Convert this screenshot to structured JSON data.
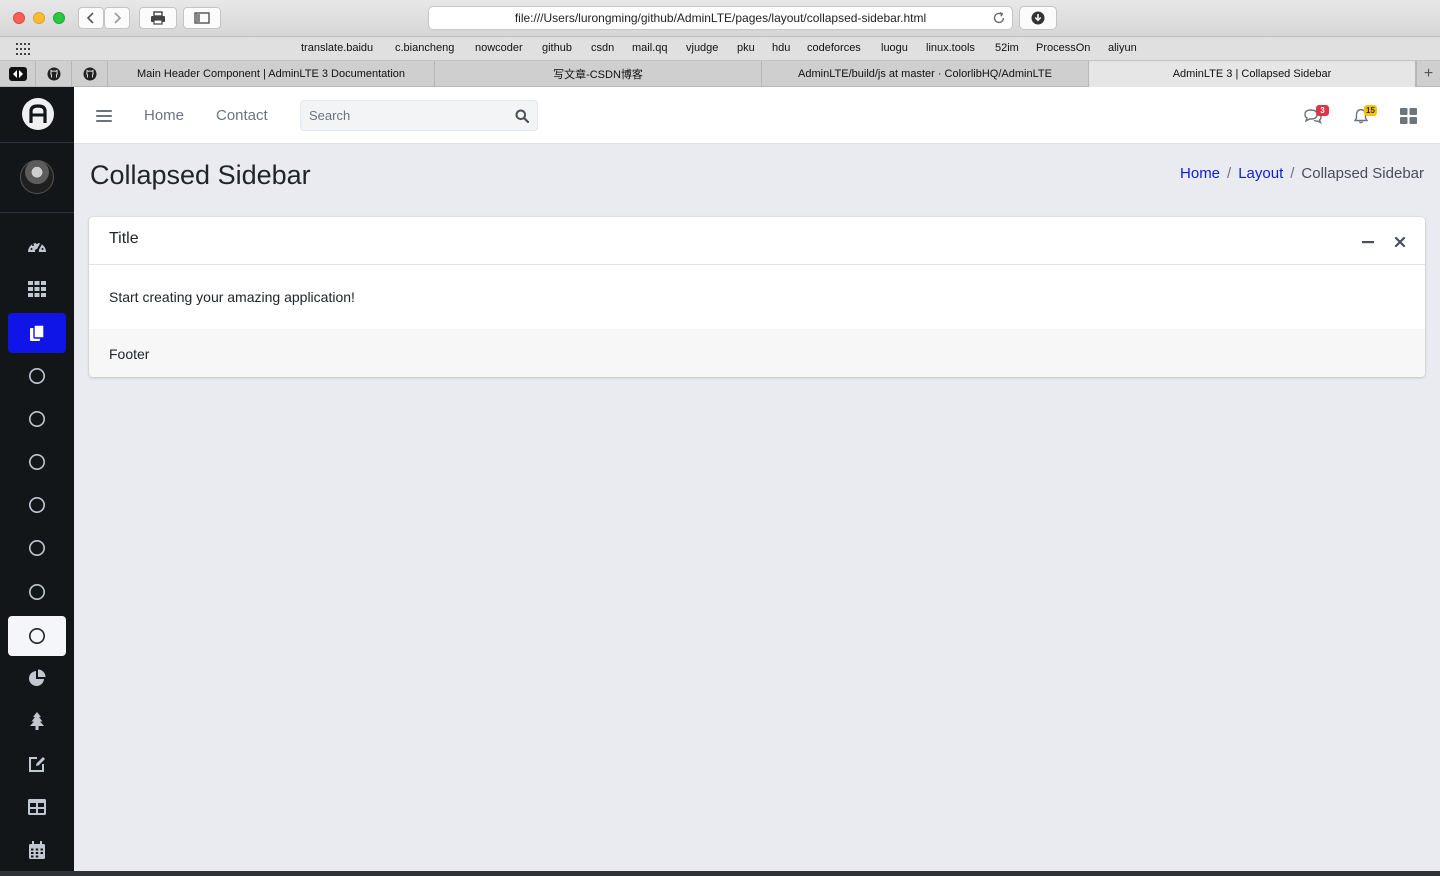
{
  "browser": {
    "url": "file:///Users/lurongming/github/AdminLTE/pages/layout/collapsed-sidebar.html",
    "bookmarks": [
      "translate.baidu",
      "c.biancheng",
      "nowcoder",
      "github",
      "csdn",
      "mail.qq",
      "vjudge",
      "pku",
      "hdu",
      "codeforces",
      "luogu",
      "linux.tools",
      "52im",
      "ProcessOn",
      "aliyun"
    ],
    "tabs": [
      {
        "label": "Main Header Component | AdminLTE 3 Documentation"
      },
      {
        "label": "写文章-CSDN博客"
      },
      {
        "label": "AdminLTE/build/js at master · ColorlibHQ/AdminLTE"
      },
      {
        "label": "AdminLTE 3 | Collapsed Sidebar"
      }
    ],
    "new_tab": "+"
  },
  "sidebar": {
    "brand_icon": "adminlte-logo-icon",
    "items": [
      {
        "icon": "dashboard-gauge-icon"
      },
      {
        "icon": "th-grid-icon"
      },
      {
        "icon": "copy-pages-icon",
        "state": "active"
      },
      {
        "icon": "circle-icon"
      },
      {
        "icon": "circle-icon"
      },
      {
        "icon": "circle-icon"
      },
      {
        "icon": "circle-icon"
      },
      {
        "icon": "circle-icon"
      },
      {
        "icon": "circle-icon"
      },
      {
        "icon": "circle-icon",
        "state": "selected"
      },
      {
        "icon": "chart-pie-icon"
      },
      {
        "icon": "tree-icon"
      },
      {
        "icon": "edit-icon"
      },
      {
        "icon": "table-icon"
      },
      {
        "icon": "calendar-icon"
      }
    ]
  },
  "navbar": {
    "links": [
      "Home",
      "Contact"
    ],
    "search_placeholder": "Search",
    "messages_count": "3",
    "notifications_count": "15",
    "colors": {
      "messages_badge": "#dc3545",
      "notifications_badge": "#ffc107"
    }
  },
  "content": {
    "page_title": "Collapsed Sidebar",
    "breadcrumb": [
      {
        "label": "Home"
      },
      {
        "label": "Layout"
      },
      {
        "label": "Collapsed Sidebar"
      }
    ],
    "breadcrumb_separator": "/",
    "card": {
      "title": "Title",
      "body": "Start creating your amazing application!",
      "footer": "Footer"
    }
  },
  "colors": {
    "sidebar_bg": "#131619",
    "active_item": "#0e15e6",
    "content_bg": "#e9ebf0",
    "link": "#0d1fd6"
  }
}
